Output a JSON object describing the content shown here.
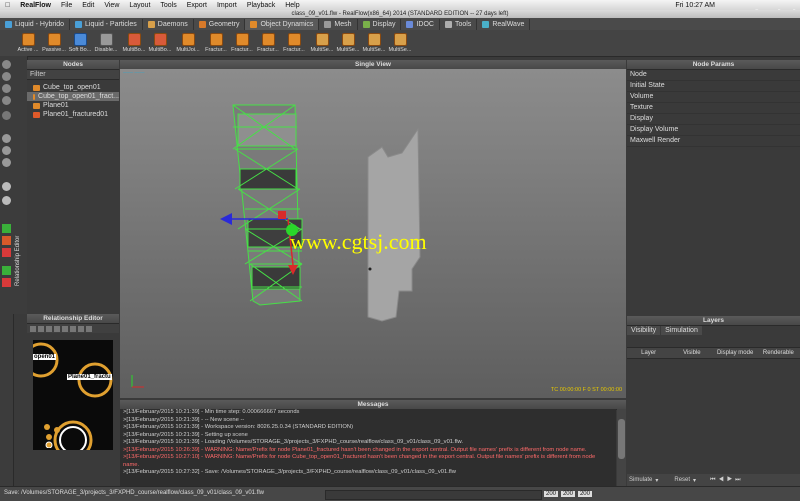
{
  "menubar": {
    "app": "RealFlow",
    "items": [
      "File",
      "Edit",
      "View",
      "Layout",
      "Tools",
      "Export",
      "Import",
      "Playback",
      "Help"
    ],
    "clock": "Fri 10:27 AM"
  },
  "window_title": "class_09_v01.flw - RealFlow(x86_64) 2014 (STANDARD EDITION -- 27 days left)",
  "tabs": [
    {
      "label": "Liquid - Hybrido",
      "color": "#4aa0d8"
    },
    {
      "label": "Liquid - Particles",
      "color": "#4aa0d8"
    },
    {
      "label": "Daemons",
      "color": "#d8a04a"
    },
    {
      "label": "Geometry",
      "color": "#d87a2a"
    },
    {
      "label": "Object Dynamics",
      "color": "#e08a2a"
    },
    {
      "label": "Mesh",
      "color": "#9a9a9a"
    },
    {
      "label": "Display",
      "color": "#7ab04a"
    },
    {
      "label": "IDOC",
      "color": "#6a8ad8"
    },
    {
      "label": "Tools",
      "color": "#b0b0b0"
    },
    {
      "label": "RealWave",
      "color": "#4ab0c8"
    }
  ],
  "shelf": [
    "Active ...",
    "Passive...",
    "Soft Bo...",
    "Disable...",
    "MultiBo...",
    "MultiBo...",
    "MultiJoi...",
    "Fractur...",
    "Fractur...",
    "Fractur...",
    "Fractur...",
    "MultiSe...",
    "MultiSe...",
    "MultiSe...",
    "MultiSe..."
  ],
  "nodes": {
    "title": "Nodes",
    "filter": "Filter",
    "items": [
      {
        "label": "Cube_top_open01",
        "color": "#e08a2a"
      },
      {
        "label": "Cube_top_open01_fract...",
        "color": "#e08a2a"
      },
      {
        "label": "Plane01",
        "color": "#e08a2a"
      },
      {
        "label": "Plane01_fractured01",
        "color": "#e05a2a"
      }
    ]
  },
  "viewport": {
    "title": "Single View",
    "timecode": "TC 00:00:00   F 0   ST 00:00:00"
  },
  "watermark": "www.cgtsj.com",
  "node_params": {
    "title": "Node Params",
    "items": [
      "Node",
      "Initial State",
      "Volume",
      "Texture",
      "Display",
      "Display Volume",
      "Maxwell Render"
    ]
  },
  "layers": {
    "title": "Layers",
    "tabs": [
      "Visibility",
      "Simulation"
    ],
    "columns": [
      "Layer",
      "Visible",
      "Display mode",
      "Renderable"
    ],
    "simulate_label": "Simulate",
    "reset_label": "Reset"
  },
  "relationship": {
    "title": "Relationship Editor",
    "sidebar_label": "Relationship Editor",
    "node_a": "open01",
    "node_b": "Plane01_fractu"
  },
  "messages": {
    "title": "Messages",
    "lines": [
      {
        "text": ">[13/February/2015 10:21:39] - Min time step: 0.000666667 seconds",
        "warn": false
      },
      {
        "text": ">[13/February/2015 10:21:39] - -- New scene --",
        "warn": false
      },
      {
        "text": ">[13/February/2015 10:21:39] - Workspace version: 8026.25.0.34 (STANDARD EDITION)",
        "warn": false
      },
      {
        "text": ">[13/February/2015 10:21:39] - Setting up scene",
        "warn": false
      },
      {
        "text": ">[13/February/2015 10:21:39] - Loading /Volumes/STORAGE_3/projects_3/FXPHD_course/realflow/class_09_v01/class_09_v01.flw.",
        "warn": false
      },
      {
        "text": ">[13/February/2015 10:26:39] - WARNING: Name/Prefix for node Plane01_fractured hasn't been changed in the export central. Output file names' prefix is different from node name.",
        "warn": true
      },
      {
        "text": ">[13/February/2015 10:27:10] - WARNING: Name/Prefix for node Cube_top_open01_fractured hasn't been changed in the export central. Output file names' prefix is different from node",
        "warn": true
      },
      {
        "text": "name.",
        "warn": true
      },
      {
        "text": ">[13/February/2015 10:27:32] - Save: /Volumes/STORAGE_3/projects_3/FXPHD_course/realflow/class_09_v01/class_09_v01.flw",
        "warn": false
      }
    ]
  },
  "status": "Save: /Volumes/STORAGE_3/projects_3/FXPHD_course/realflow/class_09_v01/class_09_v01.flw",
  "timeline": {
    "start": "0",
    "end_a": "200",
    "end_b": "200",
    "end_c": "200"
  },
  "logo": "fxphd"
}
